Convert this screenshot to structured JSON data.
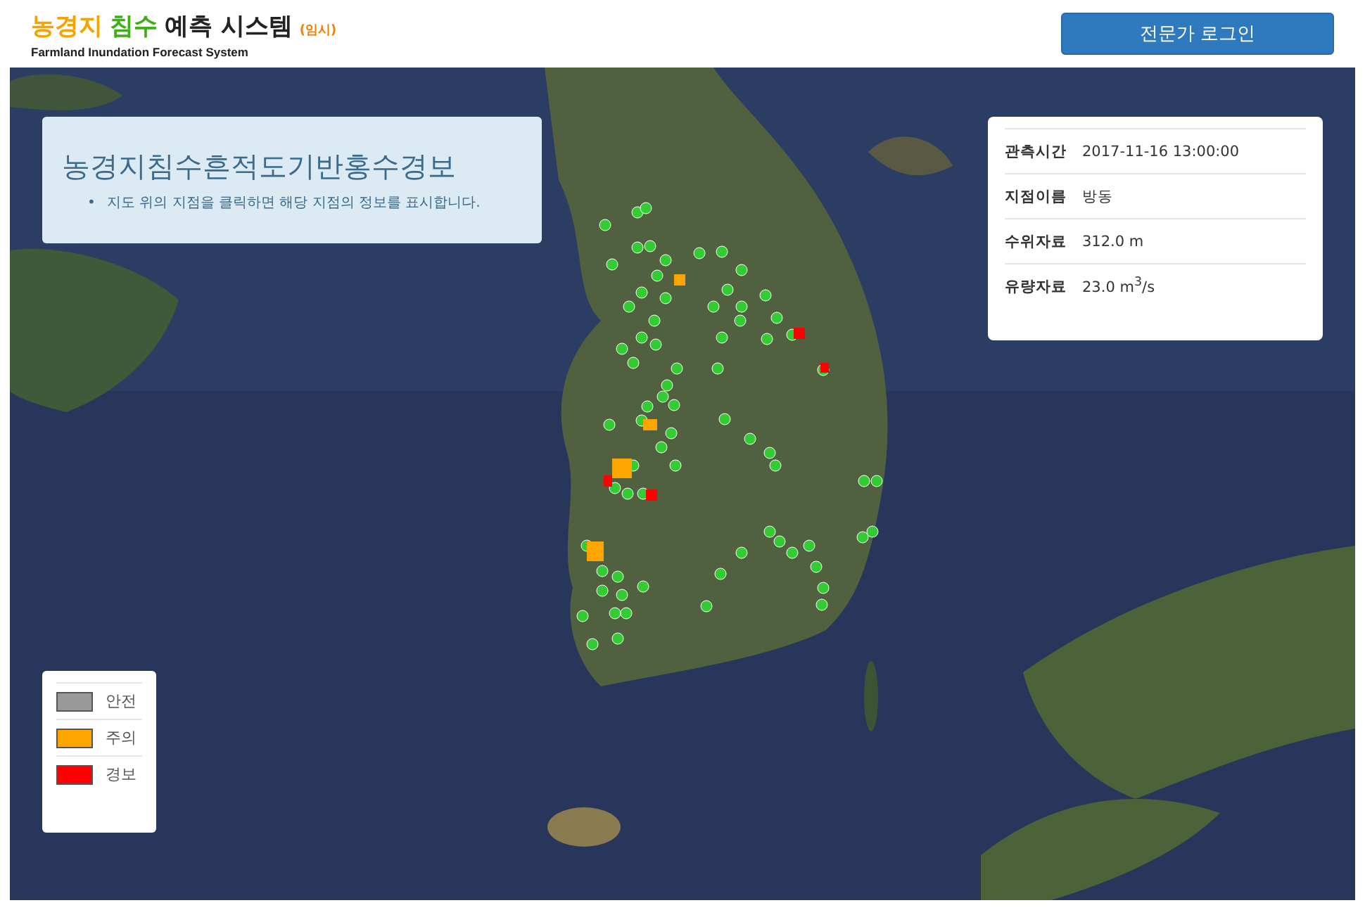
{
  "header": {
    "title_parts": [
      {
        "text": "농경지",
        "color": "#f5a300"
      },
      {
        "text": "침수",
        "color": "#3cb014"
      },
      {
        "text": "예측 시스템",
        "color": "#222222"
      }
    ],
    "title_tag": "(임시)",
    "subtitle": "Farmland Inundation Forecast System",
    "login_button": "전문가 로그인"
  },
  "info_panel": {
    "title": "농경지침수흔적도기반홍수경보",
    "bullets": [
      {
        "marker": "•",
        "text": "지도 위의 지점을 클릭하면 해당 지점의 정보를 표시합니다."
      }
    ]
  },
  "detail_panel": {
    "rows": [
      {
        "label": "관측시간",
        "value": "2017-11-16 13:00:00"
      },
      {
        "label": "지점이름",
        "value": "방동"
      },
      {
        "label": "수위자료",
        "value": "312.0 m"
      },
      {
        "label": "유량자료",
        "value": "23.0 m$^{3}$/s"
      }
    ]
  },
  "legend": [
    {
      "label": "안전",
      "color": "#999999"
    },
    {
      "label": "주의",
      "color": "#ffa500"
    },
    {
      "label": "경보",
      "color": "#ff0000"
    }
  ]
}
